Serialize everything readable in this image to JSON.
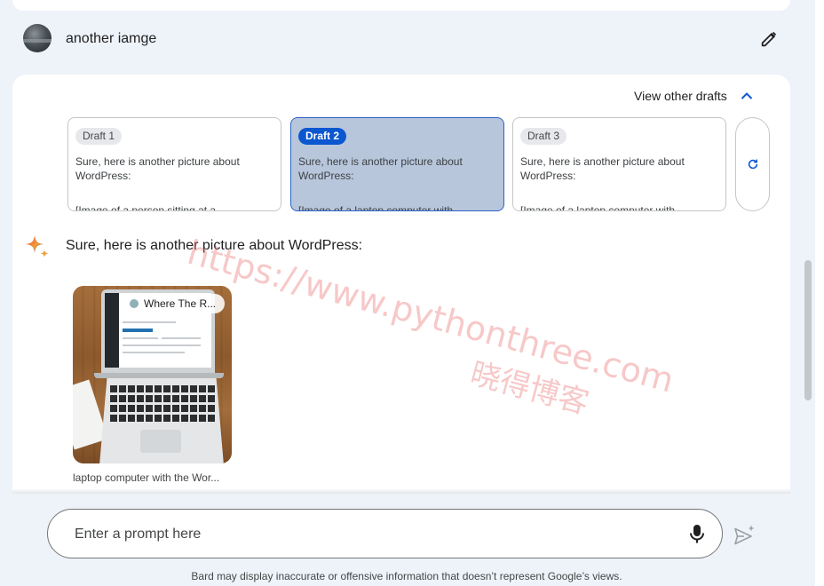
{
  "user_message": {
    "text": "another iamge",
    "avatar_icon": "avatar-image",
    "edit_icon": "pencil-icon"
  },
  "drafts": {
    "toggle_label": "View other drafts",
    "toggle_icon": "chevron-up-icon",
    "items": [
      {
        "label": "Draft 1",
        "text": "Sure, here is another picture about WordPress:",
        "clipped": "[Image of a person sitting at a",
        "selected": false
      },
      {
        "label": "Draft 2",
        "text": "Sure, here is another picture about WordPress:",
        "clipped": "[Image of a laptop computer with",
        "selected": true
      },
      {
        "label": "Draft 3",
        "text": "Sure, here is another picture about WordPress:",
        "clipped": "[Image of a laptop computer with",
        "selected": false
      }
    ],
    "regenerate_icon": "refresh-icon"
  },
  "response": {
    "icon": "bard-sparkle-icon",
    "text": "Sure, here is another picture about WordPress:",
    "image": {
      "source_chip": "Where The R...",
      "caption": "laptop computer with the Wor..."
    }
  },
  "prompt": {
    "placeholder": "Enter a prompt here",
    "mic_icon": "microphone-icon",
    "send_icon": "send-icon"
  },
  "footer": {
    "disclaimer": "Bard may display inaccurate or offensive information that doesn’t represent Google’s views."
  },
  "watermark": {
    "url": "https://www.pythonthree.com",
    "cn": "晓得博客"
  },
  "colors": {
    "page_bg": "#eef2f9",
    "selected_draft_bg": "#b8c6dc",
    "selected_pill": "#0b57d0",
    "watermark": "#eb6e6e"
  }
}
